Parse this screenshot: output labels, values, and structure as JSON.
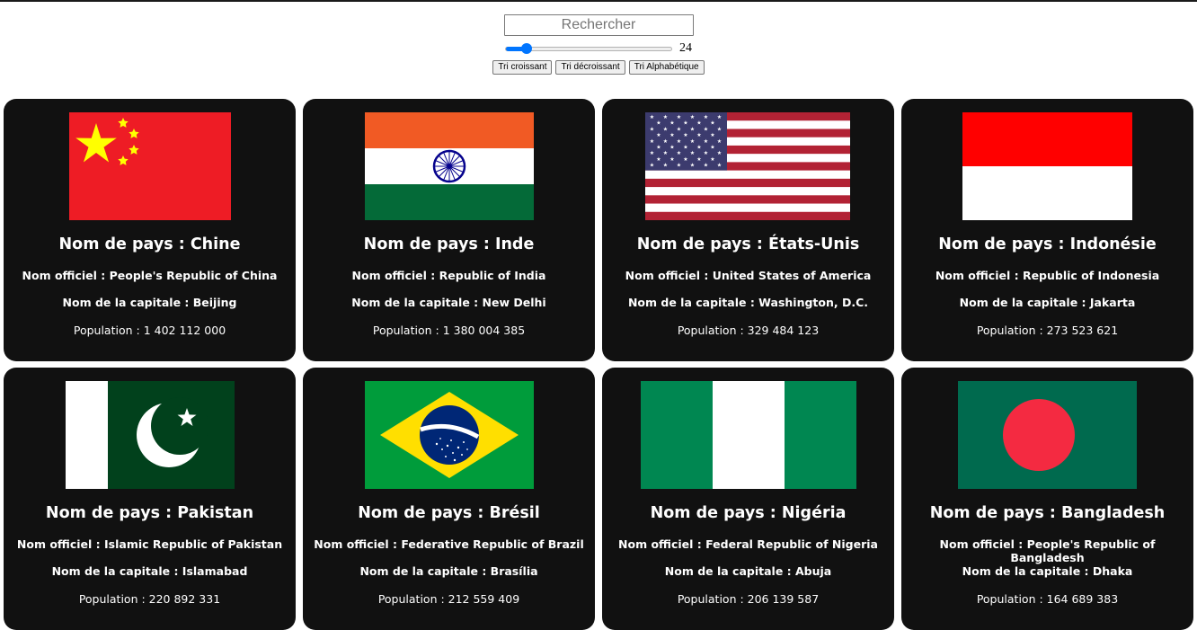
{
  "search": {
    "placeholder": "Rechercher",
    "value": ""
  },
  "slider": {
    "value": "24",
    "min": 1,
    "max": 250,
    "fraction": 0.1
  },
  "buttons": {
    "asc": "Tri croissant",
    "desc": "Tri décroissant",
    "alpha": "Tri Alphabétique"
  },
  "countries": [
    {
      "name": "Nom de pays : Chine",
      "official": "Nom officiel : People's Republic of China",
      "capital": "Nom de la capitale : Beijing",
      "population": "Population : 1 402 112 000",
      "flag": "china-flag"
    },
    {
      "name": "Nom de pays : Inde",
      "official": "Nom officiel : Republic of India",
      "capital": "Nom de la capitale : New Delhi",
      "population": "Population : 1 380 004 385",
      "flag": "india-flag"
    },
    {
      "name": "Nom de pays : États-Unis",
      "official": "Nom officiel : United States of America",
      "capital": "Nom de la capitale : Washington, D.C.",
      "population": "Population : 329 484 123",
      "flag": "usa-flag"
    },
    {
      "name": "Nom de pays : Indonésie",
      "official": "Nom officiel : Republic of Indonesia",
      "capital": "Nom de la capitale : Jakarta",
      "population": "Population : 273 523 621",
      "flag": "indonesia-flag"
    },
    {
      "name": "Nom de pays : Pakistan",
      "official": "Nom officiel : Islamic Republic of Pakistan",
      "capital": "Nom de la capitale : Islamabad",
      "population": "Population : 220 892 331",
      "flag": "pakistan-flag"
    },
    {
      "name": "Nom de pays : Brésil",
      "official": "Nom officiel : Federative Republic of Brazil",
      "capital": "Nom de la capitale : Brasília",
      "population": "Population : 212 559 409",
      "flag": "brazil-flag"
    },
    {
      "name": "Nom de pays : Nigéria",
      "official": "Nom officiel : Federal Republic of Nigeria",
      "capital": "Nom de la capitale : Abuja",
      "population": "Population : 206 139 587",
      "flag": "nigeria-flag"
    },
    {
      "name": "Nom de pays : Bangladesh",
      "official": "Nom officiel : People's Republic of Bangladesh",
      "capital": "Nom de la capitale : Dhaka",
      "population": "Population : 164 689 383",
      "flag": "bangladesh-flag"
    }
  ],
  "colors": {
    "card_bg": "#111111",
    "accent": "#0075ff"
  }
}
